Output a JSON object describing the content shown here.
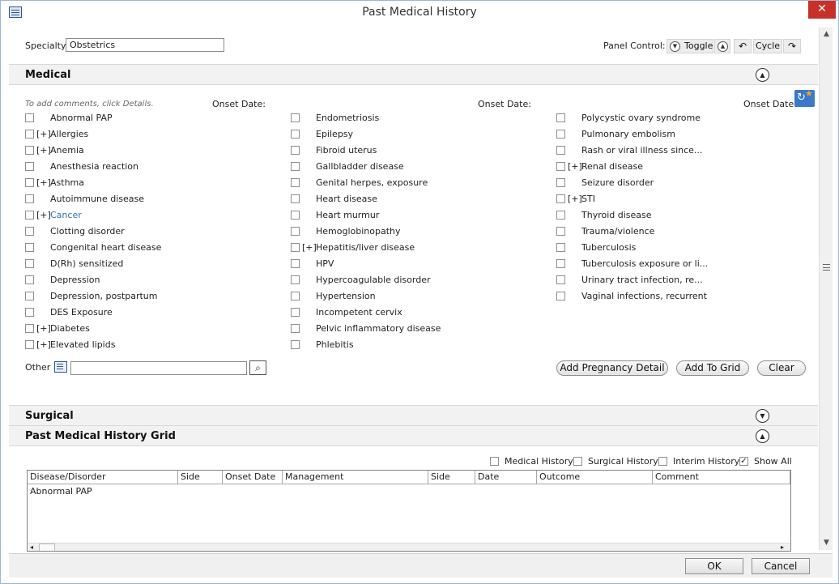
{
  "window": {
    "title": "Past Medical History",
    "close_glyph": "✕"
  },
  "specialty": {
    "label": "Specialty:",
    "value": "Obstetrics"
  },
  "panel_control": {
    "label": "Panel Control:",
    "toggle_label": "Toggle",
    "cycle_label": "Cycle"
  },
  "sections": {
    "medical": {
      "title": "Medical",
      "state": "expanded"
    },
    "surgical": {
      "title": "Surgical",
      "state": "collapsed"
    },
    "grid": {
      "title": "Past Medical History Grid",
      "state": "expanded"
    }
  },
  "medical": {
    "hint": "To add comments, click Details.",
    "onset_date_label": "Onset Date:",
    "columns": [
      [
        {
          "label": "Abnormal PAP",
          "expand": false,
          "link": false
        },
        {
          "label": "Allergies",
          "expand": true,
          "link": false
        },
        {
          "label": "Anemia",
          "expand": true,
          "link": false
        },
        {
          "label": "Anesthesia reaction",
          "expand": false,
          "link": false
        },
        {
          "label": "Asthma",
          "expand": true,
          "link": false
        },
        {
          "label": "Autoimmune disease",
          "expand": false,
          "link": false
        },
        {
          "label": "Cancer",
          "expand": true,
          "link": true
        },
        {
          "label": "Clotting disorder",
          "expand": false,
          "link": false
        },
        {
          "label": "Congenital heart disease",
          "expand": false,
          "link": false
        },
        {
          "label": "D(Rh) sensitized",
          "expand": false,
          "link": false
        },
        {
          "label": "Depression",
          "expand": false,
          "link": false
        },
        {
          "label": "Depression, postpartum",
          "expand": false,
          "link": false
        },
        {
          "label": "DES Exposure",
          "expand": false,
          "link": false
        },
        {
          "label": "Diabetes",
          "expand": true,
          "link": false
        },
        {
          "label": "Elevated lipids",
          "expand": true,
          "link": false
        }
      ],
      [
        {
          "label": "Endometriosis",
          "expand": false,
          "link": false
        },
        {
          "label": "Epilepsy",
          "expand": false,
          "link": false
        },
        {
          "label": "Fibroid uterus",
          "expand": false,
          "link": false
        },
        {
          "label": "Gallbladder disease",
          "expand": false,
          "link": false
        },
        {
          "label": "Genital herpes, exposure",
          "expand": false,
          "link": false
        },
        {
          "label": "Heart disease",
          "expand": false,
          "link": false
        },
        {
          "label": "Heart murmur",
          "expand": false,
          "link": false
        },
        {
          "label": "Hemoglobinopathy",
          "expand": false,
          "link": false
        },
        {
          "label": "Hepatitis/liver disease",
          "expand": true,
          "link": false
        },
        {
          "label": "HPV",
          "expand": false,
          "link": false
        },
        {
          "label": "Hypercoagulable disorder",
          "expand": false,
          "link": false
        },
        {
          "label": "Hypertension",
          "expand": false,
          "link": false
        },
        {
          "label": "Incompetent cervix",
          "expand": false,
          "link": false
        },
        {
          "label": "Pelvic inflammatory disease",
          "expand": false,
          "link": false
        },
        {
          "label": "Phlebitis",
          "expand": false,
          "link": false
        }
      ],
      [
        {
          "label": "Polycystic ovary syndrome",
          "expand": false,
          "link": false
        },
        {
          "label": "Pulmonary embolism",
          "expand": false,
          "link": false
        },
        {
          "label": "Rash or viral illness since...",
          "expand": false,
          "link": false
        },
        {
          "label": "Renal disease",
          "expand": true,
          "link": false
        },
        {
          "label": "Seizure disorder",
          "expand": false,
          "link": false
        },
        {
          "label": "STI",
          "expand": true,
          "link": false
        },
        {
          "label": "Thyroid disease",
          "expand": false,
          "link": false
        },
        {
          "label": "Trauma/violence",
          "expand": false,
          "link": false
        },
        {
          "label": "Tuberculosis",
          "expand": false,
          "link": false
        },
        {
          "label": "Tuberculosis exposure or li...",
          "expand": false,
          "link": false
        },
        {
          "label": "Urinary tract infection, re...",
          "expand": false,
          "link": false
        },
        {
          "label": "Vaginal infections, recurrent",
          "expand": false,
          "link": false
        }
      ]
    ],
    "expander_text": "[+]",
    "other_label": "Other",
    "other_value": "",
    "buttons": {
      "add_pregnancy": "Add Pregnancy Detail",
      "add_to_grid": "Add To Grid",
      "clear": "Clear"
    }
  },
  "grid": {
    "filters": [
      {
        "label": "Medical History",
        "checked": false
      },
      {
        "label": "Surgical History",
        "checked": false
      },
      {
        "label": "Interim History",
        "checked": false
      },
      {
        "label": "Show All",
        "checked": true
      }
    ],
    "columns": [
      "Disease/Disorder",
      "Side",
      "Onset Date",
      "Management",
      "Side",
      "Date",
      "Outcome",
      "Comment"
    ],
    "rows": [
      [
        "Abnormal PAP",
        "",
        "",
        "",
        "",
        "",
        "",
        ""
      ]
    ]
  },
  "footer": {
    "ok_label": "OK",
    "cancel_label": "Cancel"
  },
  "colors": {
    "link": "#2a6ebb",
    "close": "#c7312a"
  }
}
